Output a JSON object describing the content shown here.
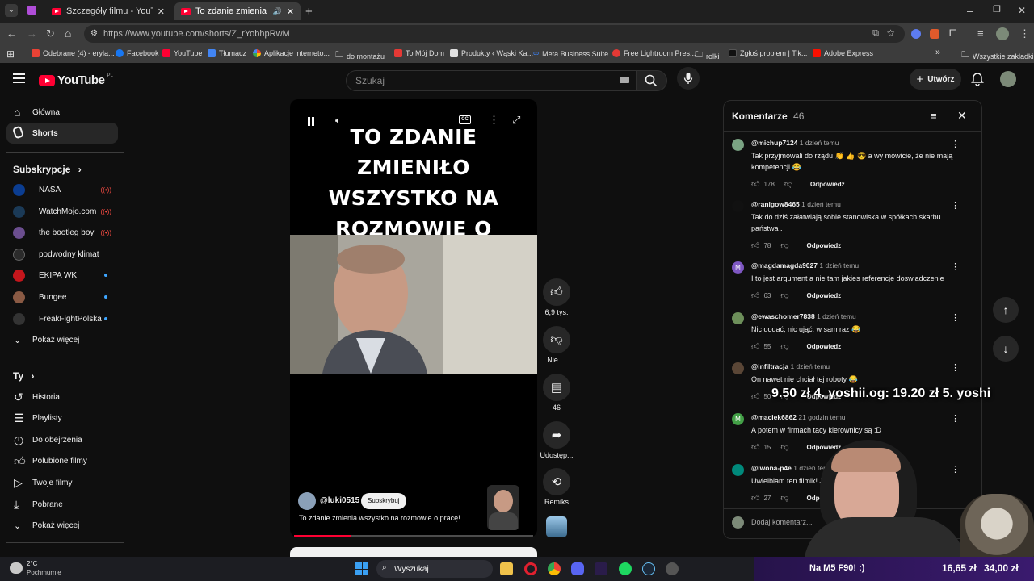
{
  "browser": {
    "tabs": [
      {
        "title": "Szczegóły filmu - YouTube Studio"
      },
      {
        "title": "To zdanie zmienia wszystko"
      }
    ],
    "url": "https://www.youtube.com/shorts/Z_rYobhpRwM",
    "bookmarks": [
      "Odebrane (4) - eryla...",
      "Facebook",
      "YouTube",
      "Tłumacz",
      "Aplikacje interneto...",
      "do montażu",
      "To Mój Dom",
      "Produkty ‹ Wąski Ka...",
      "Meta Business Suite",
      "Free Lightroom Pres...",
      "rolki",
      "Zgłoś problem | Tik...",
      "Adobe Express"
    ],
    "other_bookmarks": "Wszystkie zakładki"
  },
  "masthead": {
    "logo": "YouTube",
    "country": "PL",
    "search_placeholder": "Szukaj",
    "create_label": "Utwórz"
  },
  "sidebar": {
    "main": [
      {
        "label": "Główna",
        "icon": "home-icon"
      },
      {
        "label": "Shorts",
        "icon": "shorts-icon"
      }
    ],
    "subs_header": "Subskrypcje",
    "subscriptions": [
      {
        "label": "NASA",
        "status": "live",
        "color": "#0b3d91"
      },
      {
        "label": "WatchMojo.com",
        "status": "live",
        "color": "#1b3a57"
      },
      {
        "label": "the bootleg boy",
        "status": "live",
        "color": "#6b4e8f"
      },
      {
        "label": "podwodny klimat",
        "status": "none",
        "color": "#2b2b2b"
      },
      {
        "label": "EKIPA WK",
        "status": "new",
        "color": "#c4161c"
      },
      {
        "label": "Bungee",
        "status": "new",
        "color": "#8a5a44"
      },
      {
        "label": "FreakFightPolska",
        "status": "new",
        "color": "#333333"
      }
    ],
    "show_more": "Pokaż więcej",
    "you_header": "Ty",
    "you_items": [
      {
        "label": "Historia",
        "icon": "history-icon"
      },
      {
        "label": "Playlisty",
        "icon": "playlist-icon"
      },
      {
        "label": "Do obejrzenia",
        "icon": "watch-later-icon"
      },
      {
        "label": "Polubione filmy",
        "icon": "like-icon"
      },
      {
        "label": "Twoje filmy",
        "icon": "your-videos-icon"
      },
      {
        "label": "Pobrane",
        "icon": "download-icon"
      },
      {
        "label": "Pokaż więcej",
        "icon": "chevron-down-icon"
      }
    ]
  },
  "player": {
    "title_overlay": "To zdanie zmieniło wszystko na rozmowie o pracę!",
    "channel": "@luki0515",
    "subscribe_label": "Subskrybuj",
    "description": "To zdanie zmienia wszystko na rozmowie o pracę!",
    "progress": 0.24
  },
  "actions": {
    "likes": "6,9 tys.",
    "dislike": "Nie ...",
    "comments": "46",
    "share": "Udostęp...",
    "remix": "Remiks"
  },
  "comments_panel": {
    "title": "Komentarze",
    "count": "46",
    "add_placeholder": "Dodaj komentarz...",
    "reply_label": "Odpowiedz",
    "items": [
      {
        "author": "@michup7124",
        "time": "1 dzień temu",
        "text": "Tak przyjmowali do rządu 👏 👍 😎  a wy mówicie, że nie mają kompetencji 😂",
        "likes": "178",
        "avatar": "",
        "color": "#7aa383"
      },
      {
        "author": "@ranigow8465",
        "time": "1 dzień temu",
        "text": "Tak do dziś załatwiają sobie  stanowiska w spółkach skarbu państwa .",
        "likes": "78",
        "avatar": "",
        "color": "#111111"
      },
      {
        "author": "@magdamagda9027",
        "time": "1 dzień temu",
        "text": "I to jest argument a nie tam jakies referencje doswiadczenie",
        "likes": "63",
        "avatar": "M",
        "color": "#7e57c2"
      },
      {
        "author": "@ewaschomer7838",
        "time": "1 dzień temu",
        "text": "Nic dodać, nic ująć, w sam raz 😂",
        "likes": "55",
        "avatar": "",
        "color": "#6d8f5a"
      },
      {
        "author": "@infiltracja",
        "time": "1 dzień temu",
        "text": "On nawet nie chciał tej roboty 😂",
        "likes": "50",
        "avatar": "",
        "color": "#5a4636"
      },
      {
        "author": "@maciek6862",
        "time": "21 godzin temu",
        "text": "A potem w firmach tacy kierownicy są :D",
        "likes": "15",
        "avatar": "M",
        "color": "#43a047"
      },
      {
        "author": "@iwona-p4e",
        "time": "1 dzień temu",
        "text": "Uwielbiam ten filmik! Jest z",
        "likes": "27",
        "avatar": "I",
        "color": "#00897b"
      }
    ]
  },
  "stream_overlay": {
    "ticker": "9.50 zł   4. yoshii.og: 19.20 zł   5. yoshi",
    "goal": "Na M5 F90! :)",
    "left_amount": "16,65 zł",
    "right_amount": "34,00 zł"
  },
  "taskbar": {
    "weather_temp": "2°C",
    "weather_desc": "Pochmurnie",
    "search_label": "Wyszukaj"
  }
}
